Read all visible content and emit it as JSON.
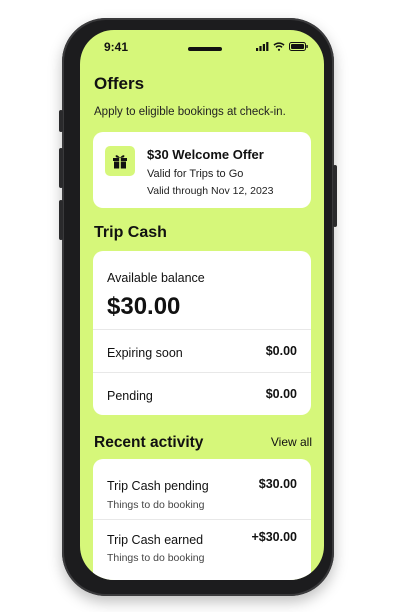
{
  "status_bar": {
    "time": "9:41"
  },
  "offers": {
    "title": "Offers",
    "subtitle": "Apply to eligible bookings at check-in.",
    "card": {
      "icon": "gift-icon",
      "title": "$30 Welcome Offer",
      "line1": "Valid for Trips to Go",
      "line2": "Valid through Nov 12, 2023"
    }
  },
  "trip_cash": {
    "title": "Trip Cash",
    "balance_label": "Available balance",
    "balance_value": "$30.00",
    "rows": [
      {
        "label": "Expiring soon",
        "value": "$0.00"
      },
      {
        "label": "Pending",
        "value": "$0.00"
      }
    ]
  },
  "recent_activity": {
    "title": "Recent activity",
    "view_all": "View all",
    "items": [
      {
        "title": "Trip Cash pending",
        "subtitle": "Things to do booking",
        "amount": "$30.00"
      },
      {
        "title": "Trip Cash earned",
        "subtitle": "Things to do booking",
        "amount": "+$30.00"
      }
    ]
  },
  "colors": {
    "screen_bg": "#d6f77a",
    "card_bg": "#ffffff",
    "text": "#111111"
  }
}
